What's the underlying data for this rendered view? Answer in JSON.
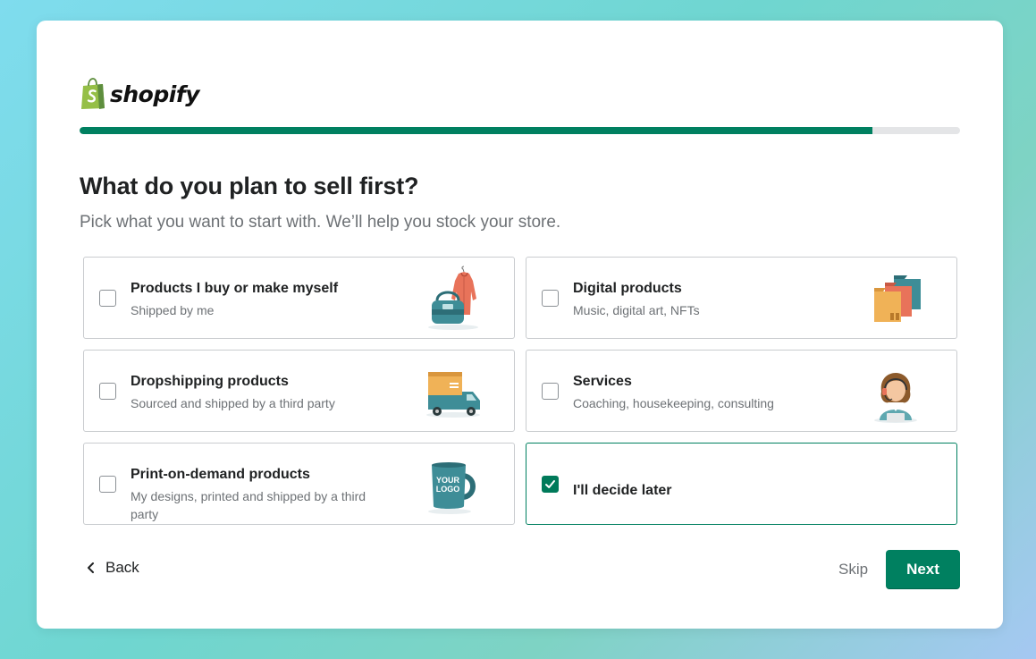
{
  "brand": {
    "name": "shopify",
    "accent": "#008060"
  },
  "progress": {
    "fraction": 0.9
  },
  "heading": {
    "title": "What do you plan to sell first?",
    "subtitle": "Pick what you want to start with. We’ll help you stock your store."
  },
  "options": [
    {
      "title": "Products I buy or make myself",
      "subtitle": "Shipped by me",
      "checked": false,
      "icon": "bag-hoodie-icon"
    },
    {
      "title": "Digital products",
      "subtitle": "Music, digital art, NFTs",
      "checked": false,
      "icon": "folders-icon"
    },
    {
      "title": "Dropshipping products",
      "subtitle": "Sourced and shipped by a third party",
      "checked": false,
      "icon": "truck-icon"
    },
    {
      "title": "Services",
      "subtitle": "Coaching, housekeeping, consulting",
      "checked": false,
      "icon": "support-agent-icon"
    },
    {
      "title": "Print-on-demand products",
      "subtitle": "My designs, printed and shipped by a third party",
      "checked": false,
      "icon": "mug-icon",
      "mug_text_1": "YOUR",
      "mug_text_2": "LOGO"
    },
    {
      "title": "I'll decide later",
      "checked": true
    }
  ],
  "footer": {
    "back_label": "Back",
    "skip_label": "Skip",
    "next_label": "Next"
  }
}
